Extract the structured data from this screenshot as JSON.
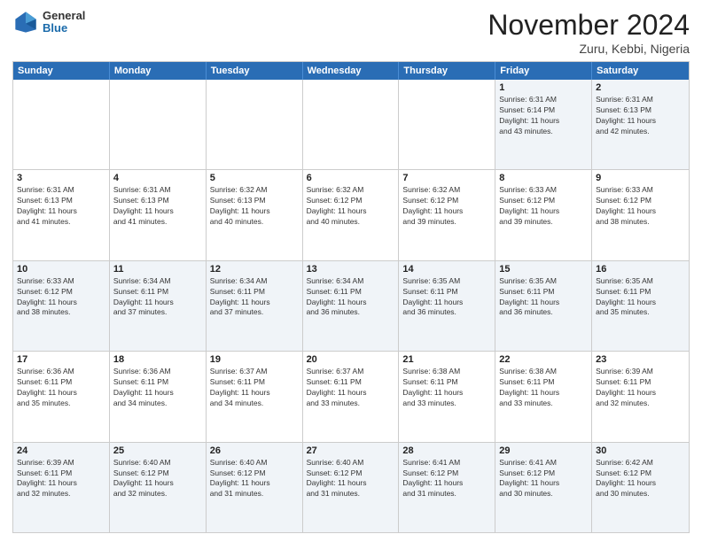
{
  "header": {
    "logo": {
      "general": "General",
      "blue": "Blue"
    },
    "title": "November 2024",
    "subtitle": "Zuru, Kebbi, Nigeria"
  },
  "calendar": {
    "days_of_week": [
      "Sunday",
      "Monday",
      "Tuesday",
      "Wednesday",
      "Thursday",
      "Friday",
      "Saturday"
    ],
    "weeks": [
      [
        {
          "day": "",
          "info": ""
        },
        {
          "day": "",
          "info": ""
        },
        {
          "day": "",
          "info": ""
        },
        {
          "day": "",
          "info": ""
        },
        {
          "day": "",
          "info": ""
        },
        {
          "day": "1",
          "info": "Sunrise: 6:31 AM\nSunset: 6:14 PM\nDaylight: 11 hours\nand 43 minutes."
        },
        {
          "day": "2",
          "info": "Sunrise: 6:31 AM\nSunset: 6:13 PM\nDaylight: 11 hours\nand 42 minutes."
        }
      ],
      [
        {
          "day": "3",
          "info": "Sunrise: 6:31 AM\nSunset: 6:13 PM\nDaylight: 11 hours\nand 41 minutes."
        },
        {
          "day": "4",
          "info": "Sunrise: 6:31 AM\nSunset: 6:13 PM\nDaylight: 11 hours\nand 41 minutes."
        },
        {
          "day": "5",
          "info": "Sunrise: 6:32 AM\nSunset: 6:13 PM\nDaylight: 11 hours\nand 40 minutes."
        },
        {
          "day": "6",
          "info": "Sunrise: 6:32 AM\nSunset: 6:12 PM\nDaylight: 11 hours\nand 40 minutes."
        },
        {
          "day": "7",
          "info": "Sunrise: 6:32 AM\nSunset: 6:12 PM\nDaylight: 11 hours\nand 39 minutes."
        },
        {
          "day": "8",
          "info": "Sunrise: 6:33 AM\nSunset: 6:12 PM\nDaylight: 11 hours\nand 39 minutes."
        },
        {
          "day": "9",
          "info": "Sunrise: 6:33 AM\nSunset: 6:12 PM\nDaylight: 11 hours\nand 38 minutes."
        }
      ],
      [
        {
          "day": "10",
          "info": "Sunrise: 6:33 AM\nSunset: 6:12 PM\nDaylight: 11 hours\nand 38 minutes."
        },
        {
          "day": "11",
          "info": "Sunrise: 6:34 AM\nSunset: 6:11 PM\nDaylight: 11 hours\nand 37 minutes."
        },
        {
          "day": "12",
          "info": "Sunrise: 6:34 AM\nSunset: 6:11 PM\nDaylight: 11 hours\nand 37 minutes."
        },
        {
          "day": "13",
          "info": "Sunrise: 6:34 AM\nSunset: 6:11 PM\nDaylight: 11 hours\nand 36 minutes."
        },
        {
          "day": "14",
          "info": "Sunrise: 6:35 AM\nSunset: 6:11 PM\nDaylight: 11 hours\nand 36 minutes."
        },
        {
          "day": "15",
          "info": "Sunrise: 6:35 AM\nSunset: 6:11 PM\nDaylight: 11 hours\nand 36 minutes."
        },
        {
          "day": "16",
          "info": "Sunrise: 6:35 AM\nSunset: 6:11 PM\nDaylight: 11 hours\nand 35 minutes."
        }
      ],
      [
        {
          "day": "17",
          "info": "Sunrise: 6:36 AM\nSunset: 6:11 PM\nDaylight: 11 hours\nand 35 minutes."
        },
        {
          "day": "18",
          "info": "Sunrise: 6:36 AM\nSunset: 6:11 PM\nDaylight: 11 hours\nand 34 minutes."
        },
        {
          "day": "19",
          "info": "Sunrise: 6:37 AM\nSunset: 6:11 PM\nDaylight: 11 hours\nand 34 minutes."
        },
        {
          "day": "20",
          "info": "Sunrise: 6:37 AM\nSunset: 6:11 PM\nDaylight: 11 hours\nand 33 minutes."
        },
        {
          "day": "21",
          "info": "Sunrise: 6:38 AM\nSunset: 6:11 PM\nDaylight: 11 hours\nand 33 minutes."
        },
        {
          "day": "22",
          "info": "Sunrise: 6:38 AM\nSunset: 6:11 PM\nDaylight: 11 hours\nand 33 minutes."
        },
        {
          "day": "23",
          "info": "Sunrise: 6:39 AM\nSunset: 6:11 PM\nDaylight: 11 hours\nand 32 minutes."
        }
      ],
      [
        {
          "day": "24",
          "info": "Sunrise: 6:39 AM\nSunset: 6:11 PM\nDaylight: 11 hours\nand 32 minutes."
        },
        {
          "day": "25",
          "info": "Sunrise: 6:40 AM\nSunset: 6:12 PM\nDaylight: 11 hours\nand 32 minutes."
        },
        {
          "day": "26",
          "info": "Sunrise: 6:40 AM\nSunset: 6:12 PM\nDaylight: 11 hours\nand 31 minutes."
        },
        {
          "day": "27",
          "info": "Sunrise: 6:40 AM\nSunset: 6:12 PM\nDaylight: 11 hours\nand 31 minutes."
        },
        {
          "day": "28",
          "info": "Sunrise: 6:41 AM\nSunset: 6:12 PM\nDaylight: 11 hours\nand 31 minutes."
        },
        {
          "day": "29",
          "info": "Sunrise: 6:41 AM\nSunset: 6:12 PM\nDaylight: 11 hours\nand 30 minutes."
        },
        {
          "day": "30",
          "info": "Sunrise: 6:42 AM\nSunset: 6:12 PM\nDaylight: 11 hours\nand 30 minutes."
        }
      ]
    ]
  }
}
